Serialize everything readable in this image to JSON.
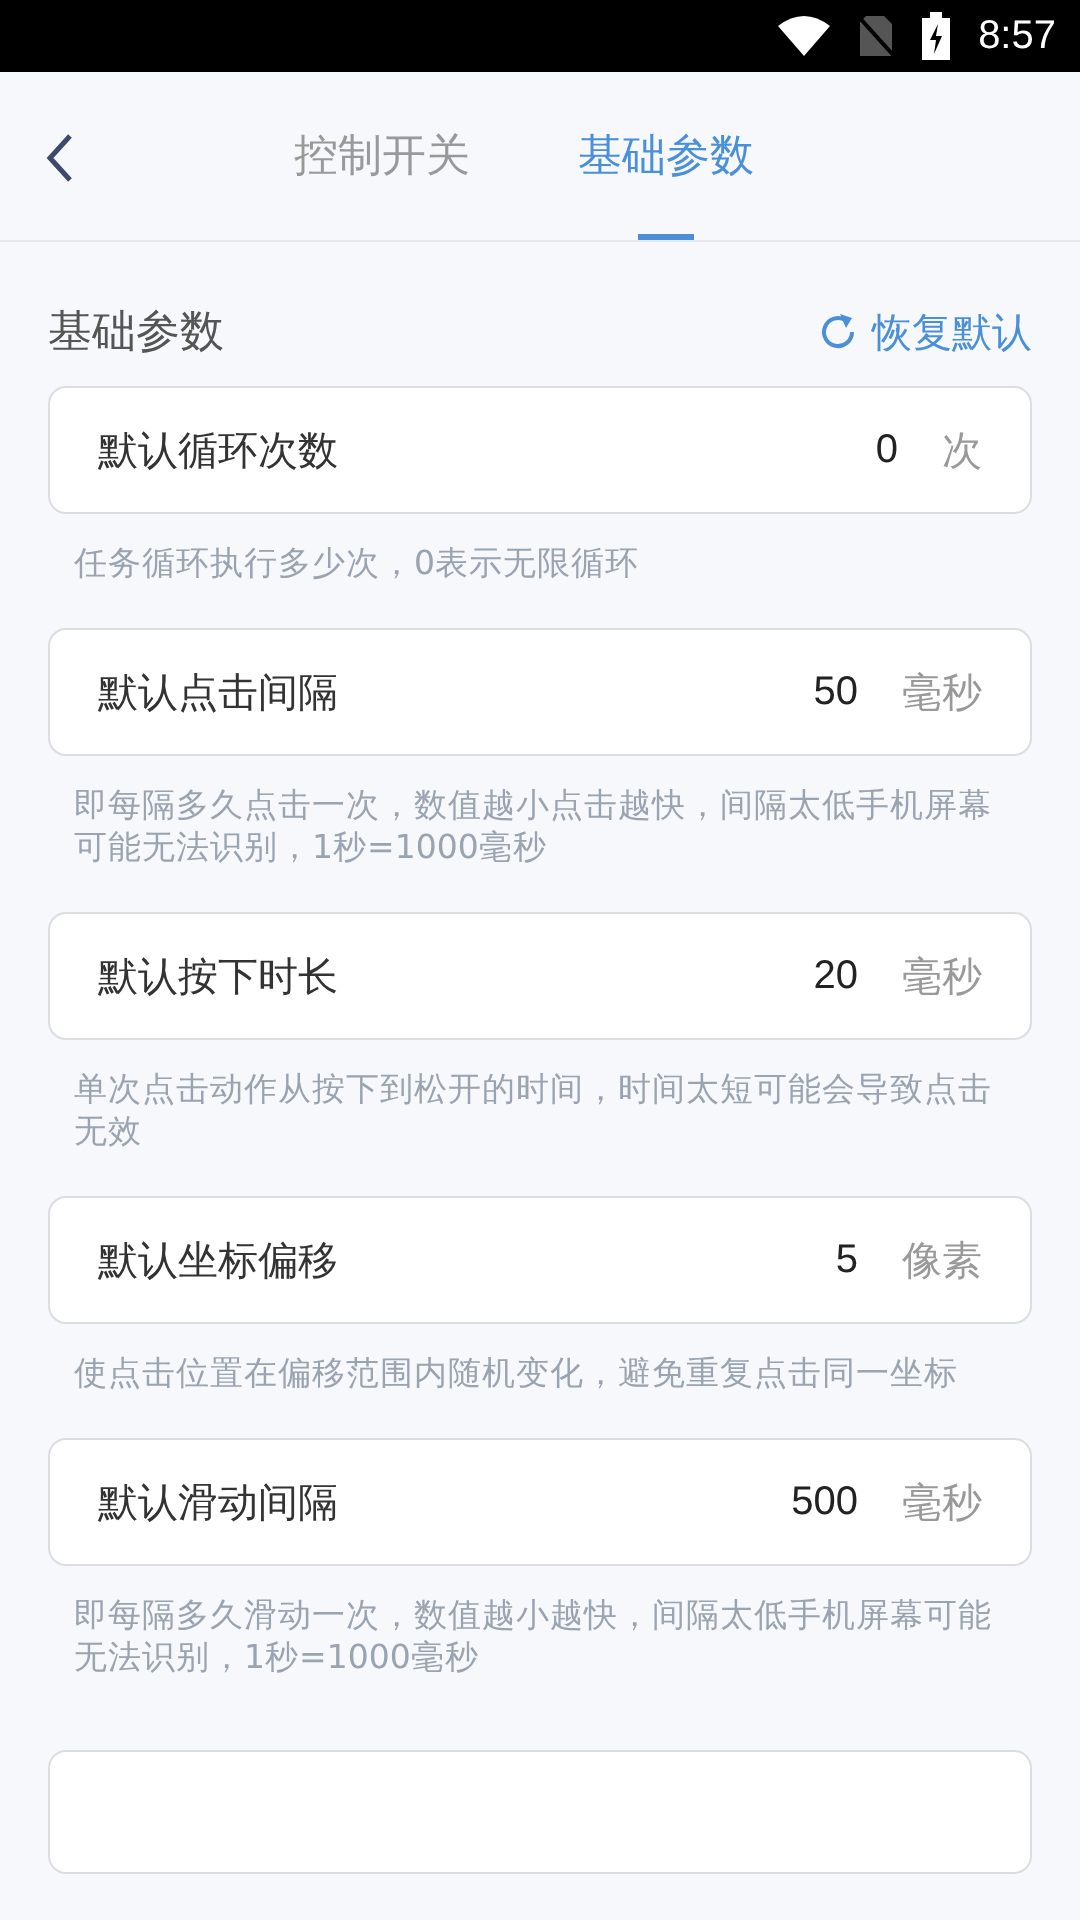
{
  "status_bar": {
    "time": "8:57"
  },
  "tabs": [
    {
      "label": "控制开关",
      "selected": false
    },
    {
      "label": "基础参数",
      "selected": true
    }
  ],
  "section": {
    "title": "基础参数",
    "reset_label": "恢复默认"
  },
  "params": [
    {
      "label": "默认循环次数",
      "value": "0",
      "unit": "次",
      "hint": "任务循环执行多少次，0表示无限循环"
    },
    {
      "label": "默认点击间隔",
      "value": "50",
      "unit": "毫秒",
      "hint": "即每隔多久点击一次，数值越小点击越快，间隔太低手机屏幕可能无法识别，1秒=1000毫秒"
    },
    {
      "label": "默认按下时长",
      "value": "20",
      "unit": "毫秒",
      "hint": "单次点击动作从按下到松开的时间，时间太短可能会导致点击无效"
    },
    {
      "label": "默认坐标偏移",
      "value": "5",
      "unit": "像素",
      "hint": "使点击位置在偏移范围内随机变化，避免重复点击同一坐标"
    },
    {
      "label": "默认滑动间隔",
      "value": "500",
      "unit": "毫秒",
      "hint": "即每隔多久滑动一次，数值越小越快，间隔太低手机屏幕可能无法识别，1秒=1000毫秒"
    }
  ]
}
